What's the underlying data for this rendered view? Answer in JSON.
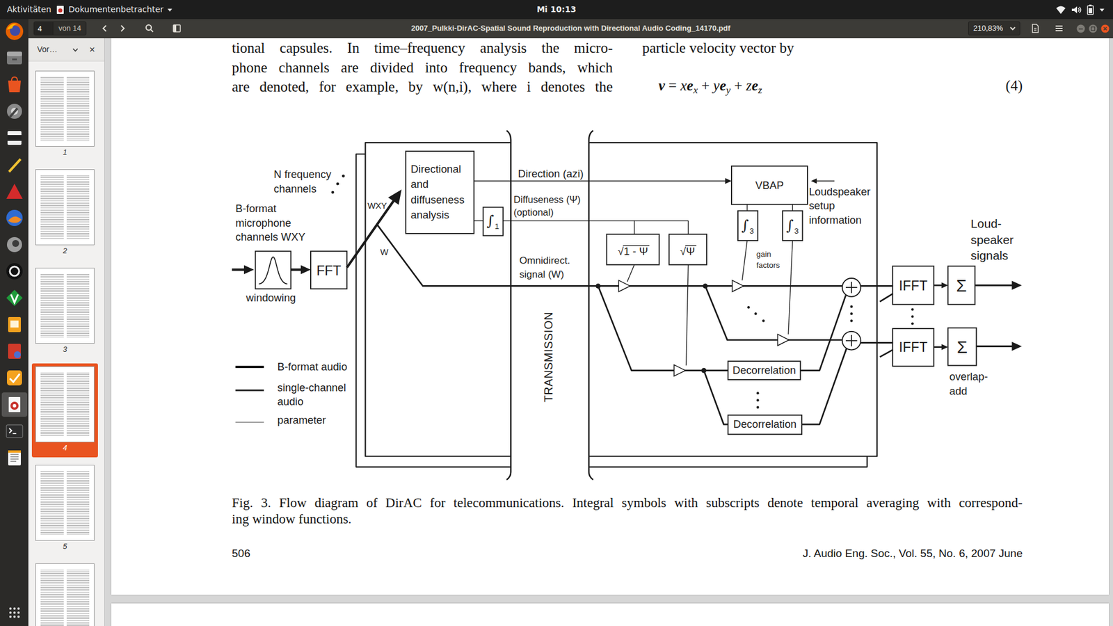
{
  "topbar": {
    "activities": "Aktivitäten",
    "app_menu": "Dokumentenbetrachter",
    "clock": "Mi 10:13"
  },
  "dock": {
    "items": [
      {
        "selected": false
      },
      {
        "selected": false
      },
      {
        "selected": false
      },
      {
        "selected": false
      },
      {
        "selected": false
      },
      {
        "selected": false
      },
      {
        "selected": false
      },
      {
        "selected": false
      },
      {
        "selected": false
      },
      {
        "selected": false
      },
      {
        "selected": false
      },
      {
        "selected": false
      },
      {
        "selected": false
      },
      {
        "selected": false
      },
      {
        "selected": true
      },
      {
        "selected": false
      },
      {
        "selected": false
      }
    ]
  },
  "toolbar": {
    "page_input": "4",
    "page_total": "von 14",
    "title": "2007_Pulkki-DirAC-Spatial Sound Reproduction with Directional Audio Coding_14170.pdf",
    "zoom": "210,83%"
  },
  "sidebar": {
    "mode": "Vor…",
    "close": "×",
    "thumbnails": [
      {
        "label": "1",
        "selected": false
      },
      {
        "label": "2",
        "selected": false
      },
      {
        "label": "3",
        "selected": false
      },
      {
        "label": "4",
        "selected": true
      },
      {
        "label": "5",
        "selected": false
      }
    ]
  },
  "document": {
    "left_lines": [
      "tional capsules. In time–frequency analysis the micro-",
      "phone channels are divided into frequency bands, which",
      "are denoted, for example, by w(n,i), where i denotes the"
    ],
    "right_line": "particle velocity vector by",
    "equation": [
      {
        "text": "v",
        "kind": "vector"
      },
      {
        "text": " = ",
        "kind": "op"
      },
      {
        "text": "x",
        "kind": "var"
      },
      {
        "text": "e",
        "kind": "vector"
      },
      {
        "text": "x",
        "kind": "sub"
      },
      {
        "text": " + ",
        "kind": "op"
      },
      {
        "text": "y",
        "kind": "var"
      },
      {
        "text": "e",
        "kind": "vector"
      },
      {
        "text": "y",
        "kind": "sub"
      },
      {
        "text": " + ",
        "kind": "op"
      },
      {
        "text": "z",
        "kind": "var"
      },
      {
        "text": "e",
        "kind": "vector"
      },
      {
        "text": "z",
        "kind": "sub"
      }
    ],
    "equation_number": "(4)",
    "caption_lines": [
      "Fig. 3. Flow diagram of DirAC for telecommunications. Integral symbols with subscripts denote temporal averaging with correspond-",
      "ing window functions."
    ],
    "footer_page": "506",
    "footer_journal": "J. Audio Eng. Soc., Vol. 55, No. 6, 2007 June"
  },
  "diagram": {
    "n_channels": [
      "N frequency",
      "channels"
    ],
    "input": [
      "B-format",
      "microphone",
      "channels WXY"
    ],
    "windowing": "windowing",
    "fft": "FFT",
    "wxy": "WXY",
    "w": "W",
    "analysis": [
      "Directional",
      "and",
      "diffuseness",
      "analysis"
    ],
    "average1": {
      "symbol": "∫",
      "sub": "1"
    },
    "direction": "Direction (azi)",
    "diffuseness": [
      "Diffuseness (Ψ)",
      "(optional)"
    ],
    "omni": [
      "Omnidirect.",
      "signal (W)"
    ],
    "transmission": "TRANSMISSION",
    "vbap": "VBAP",
    "setup": [
      "Loudspeaker",
      "setup",
      "information"
    ],
    "gain_direct": {
      "radical": "√",
      "radicand": "1 - Ψ"
    },
    "gain_diffuse": {
      "radical": "√",
      "radicand": "Ψ"
    },
    "averages3": [
      {
        "symbol": "∫",
        "sub": "3"
      },
      {
        "symbol": "∫",
        "sub": "3"
      }
    ],
    "gain": [
      "gain",
      "factors"
    ],
    "decorrelation": [
      "Decorrelation",
      "Decorrelation"
    ],
    "ifft": [
      "IFFT",
      "IFFT"
    ],
    "sum": [
      "Σ",
      "Σ"
    ],
    "outputs": [
      "Loud-",
      "speaker",
      "signals"
    ],
    "overlap": [
      "overlap-",
      "add"
    ],
    "legend": [
      {
        "kind": "bformat",
        "lines": [
          "B-format audio"
        ]
      },
      {
        "kind": "single",
        "lines": [
          "single-channel",
          "audio"
        ]
      },
      {
        "kind": "param",
        "lines": [
          "parameter"
        ]
      }
    ]
  }
}
